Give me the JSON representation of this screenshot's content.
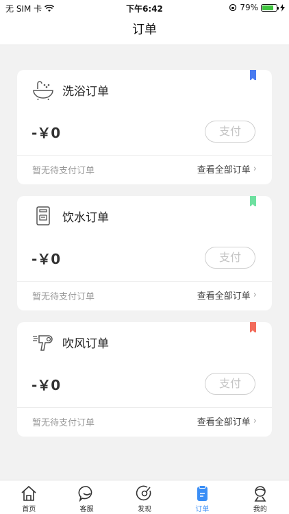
{
  "status_bar": {
    "carrier": "无 SIM 卡",
    "time": "下午6:42",
    "battery": "79%",
    "battery_level": 0.79
  },
  "nav": {
    "title": "订单"
  },
  "cards": [
    {
      "title": "洗浴订单",
      "amount": "-￥0",
      "pay_label": "支付",
      "pending_text": "暂无待支付订单",
      "view_all": "查看全部订单",
      "icon": "bath-icon",
      "bookmark_color": "#4a7bf0"
    },
    {
      "title": "饮水订单",
      "amount": "-￥0",
      "pay_label": "支付",
      "pending_text": "暂无待支付订单",
      "view_all": "查看全部订单",
      "icon": "water-dispenser-icon",
      "bookmark_color": "#6ee0a0"
    },
    {
      "title": "吹风订单",
      "amount": "-￥0",
      "pay_label": "支付",
      "pending_text": "暂无待支付订单",
      "view_all": "查看全部订单",
      "icon": "hair-dryer-icon",
      "bookmark_color": "#f26b5b"
    }
  ],
  "tabs": [
    {
      "label": "首页",
      "icon": "home-icon"
    },
    {
      "label": "客服",
      "icon": "chat-icon"
    },
    {
      "label": "发现",
      "icon": "discover-icon"
    },
    {
      "label": "订单",
      "icon": "order-icon",
      "active": true
    },
    {
      "label": "我的",
      "icon": "profile-icon"
    }
  ],
  "colors": {
    "accent": "#3a8ef6",
    "background": "#f2f2f2"
  }
}
